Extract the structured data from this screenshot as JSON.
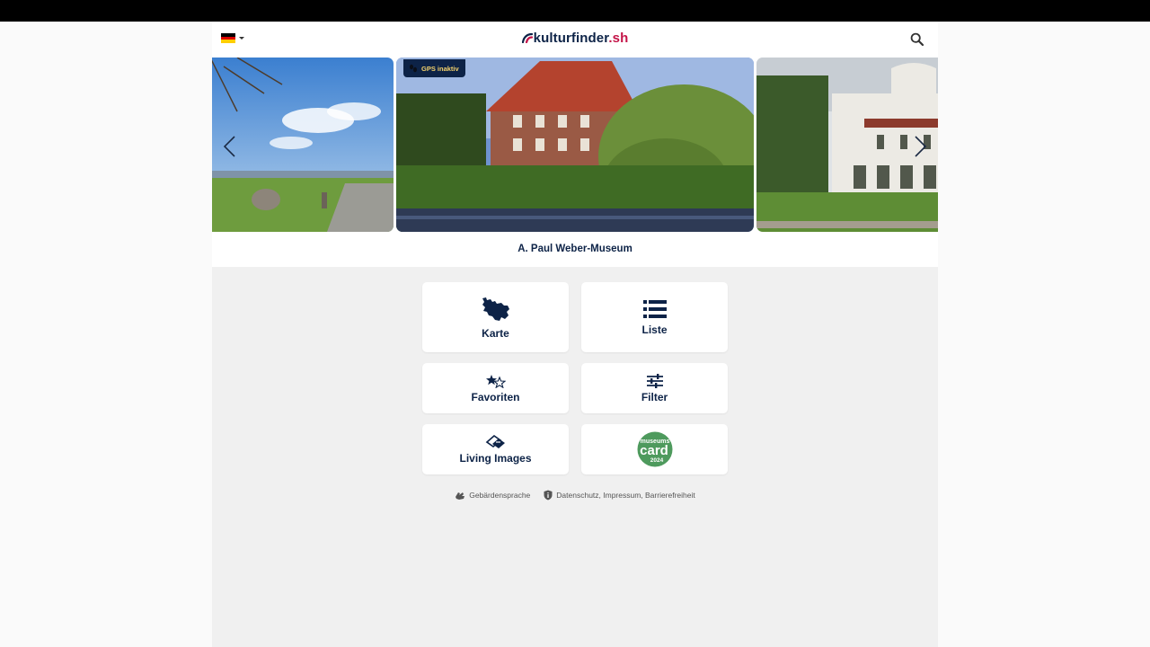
{
  "header": {
    "language": "de",
    "logo_brand": "kulturfinder",
    "logo_tld": ".sh",
    "search_icon": "search-icon"
  },
  "carousel": {
    "gps_status": "GPS inaktiv",
    "current_title": "A. Paul Weber-Museum",
    "prev_icon": "chevron-left-icon",
    "next_icon": "chevron-right-icon"
  },
  "tiles": {
    "map": "Karte",
    "list": "Liste",
    "favorites": "Favoriten",
    "filter": "Filter",
    "living_images": "Living Images",
    "museumscard_top": "museums",
    "museumscard_main": "card",
    "museumscard_year": "2024"
  },
  "footer": {
    "sign_language": "Gebärdensprache",
    "legal": "Datenschutz, Impressum, Barrierefreiheit"
  },
  "colors": {
    "primary": "#0d2347",
    "accent": "#c41448",
    "gps_text": "#f3d16b",
    "museumscard_green": "#4e9a5d"
  }
}
